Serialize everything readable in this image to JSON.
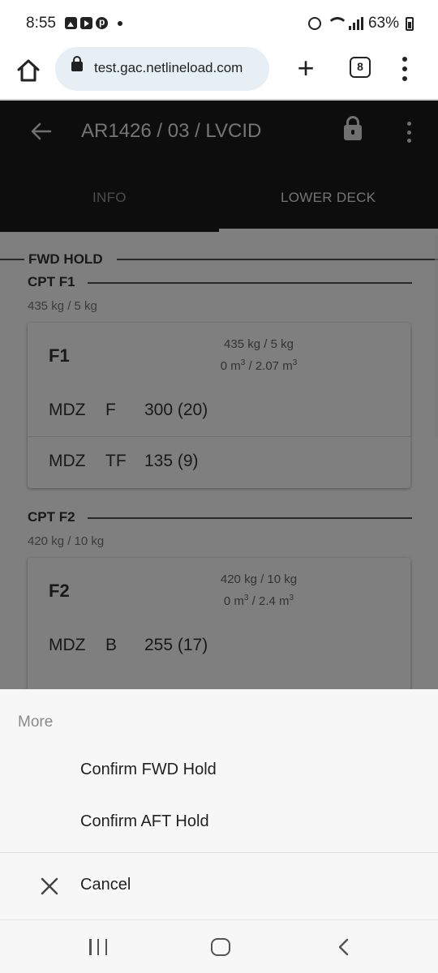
{
  "status_bar": {
    "time": "8:55",
    "battery": "63%",
    "notification_icons": [
      "gallery-icon",
      "youtube-icon",
      "pinterest-icon",
      "dot-icon"
    ],
    "system_icons": [
      "alarm-icon",
      "wifi-icon",
      "signal-icon",
      "battery-icon"
    ]
  },
  "browser": {
    "url": "test.gac.netlineload.com",
    "tab_count": "8",
    "new_tab_label": "+"
  },
  "app": {
    "title": "AR1426 / 03 / LVCID",
    "tabs": [
      {
        "label": "INFO",
        "active": false
      },
      {
        "label": "LOWER DECK",
        "active": true
      }
    ],
    "hold": {
      "title": "FWD HOLD",
      "compartments": [
        {
          "title": "CPT F1",
          "weight": "435 kg / 5 kg",
          "card": {
            "name": "F1",
            "weight": "435 kg / 5 kg",
            "volume_used": "0 m",
            "volume_total": " / 2.07 m",
            "unit_exp": "3",
            "items": [
              {
                "type": "MDZ",
                "code": "F",
                "value": "300 (20)"
              },
              {
                "type": "MDZ",
                "code": "TF",
                "value": "135 (9)"
              }
            ]
          }
        },
        {
          "title": "CPT F2",
          "weight": "420 kg / 10 kg",
          "card": {
            "name": "F2",
            "weight": "420 kg / 10 kg",
            "volume_used": "0 m",
            "volume_total": " / 2.4 m",
            "unit_exp": "3",
            "items": [
              {
                "type": "MDZ",
                "code": "B",
                "value": "255 (17)"
              }
            ]
          }
        }
      ]
    }
  },
  "sheet": {
    "title": "More",
    "items": [
      {
        "label": "Confirm FWD Hold"
      },
      {
        "label": "Confirm AFT Hold"
      }
    ],
    "cancel_label": "Cancel"
  },
  "colors": {
    "appbar": "#1b1b1b",
    "url_bg": "#e6eff6",
    "sheet_bg": "#f7f7f7"
  }
}
